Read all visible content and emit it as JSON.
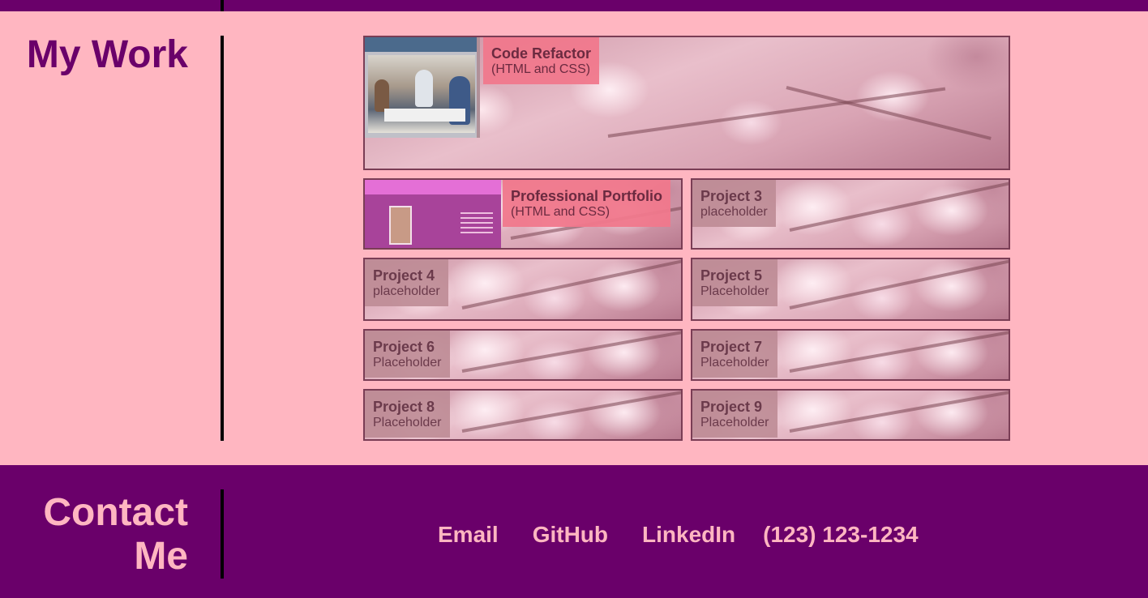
{
  "sections": {
    "work_title": "My Work",
    "contact_title_line1": "Contact",
    "contact_title_line2": "Me"
  },
  "projects": [
    {
      "title": "Code Refactor",
      "subtitle": "(HTML and CSS)"
    },
    {
      "title": "Professional Portfolio",
      "subtitle": "(HTML and CSS)"
    },
    {
      "title": "Project 3",
      "subtitle": "placeholder"
    },
    {
      "title": "Project 4",
      "subtitle": "placeholder"
    },
    {
      "title": "Project 5",
      "subtitle": "Placeholder"
    },
    {
      "title": "Project 6",
      "subtitle": "Placeholder"
    },
    {
      "title": "Project 7",
      "subtitle": "Placeholder"
    },
    {
      "title": "Project 8",
      "subtitle": "Placeholder"
    },
    {
      "title": "Project 9",
      "subtitle": "Placeholder"
    }
  ],
  "contact": {
    "email": "Email",
    "github": "GitHub",
    "linkedin": "LinkedIn",
    "phone": "(123) 123-1234"
  },
  "colors": {
    "background": "#ffb6c1",
    "accent": "#6a006a",
    "label_highlight": "#f0788c"
  }
}
